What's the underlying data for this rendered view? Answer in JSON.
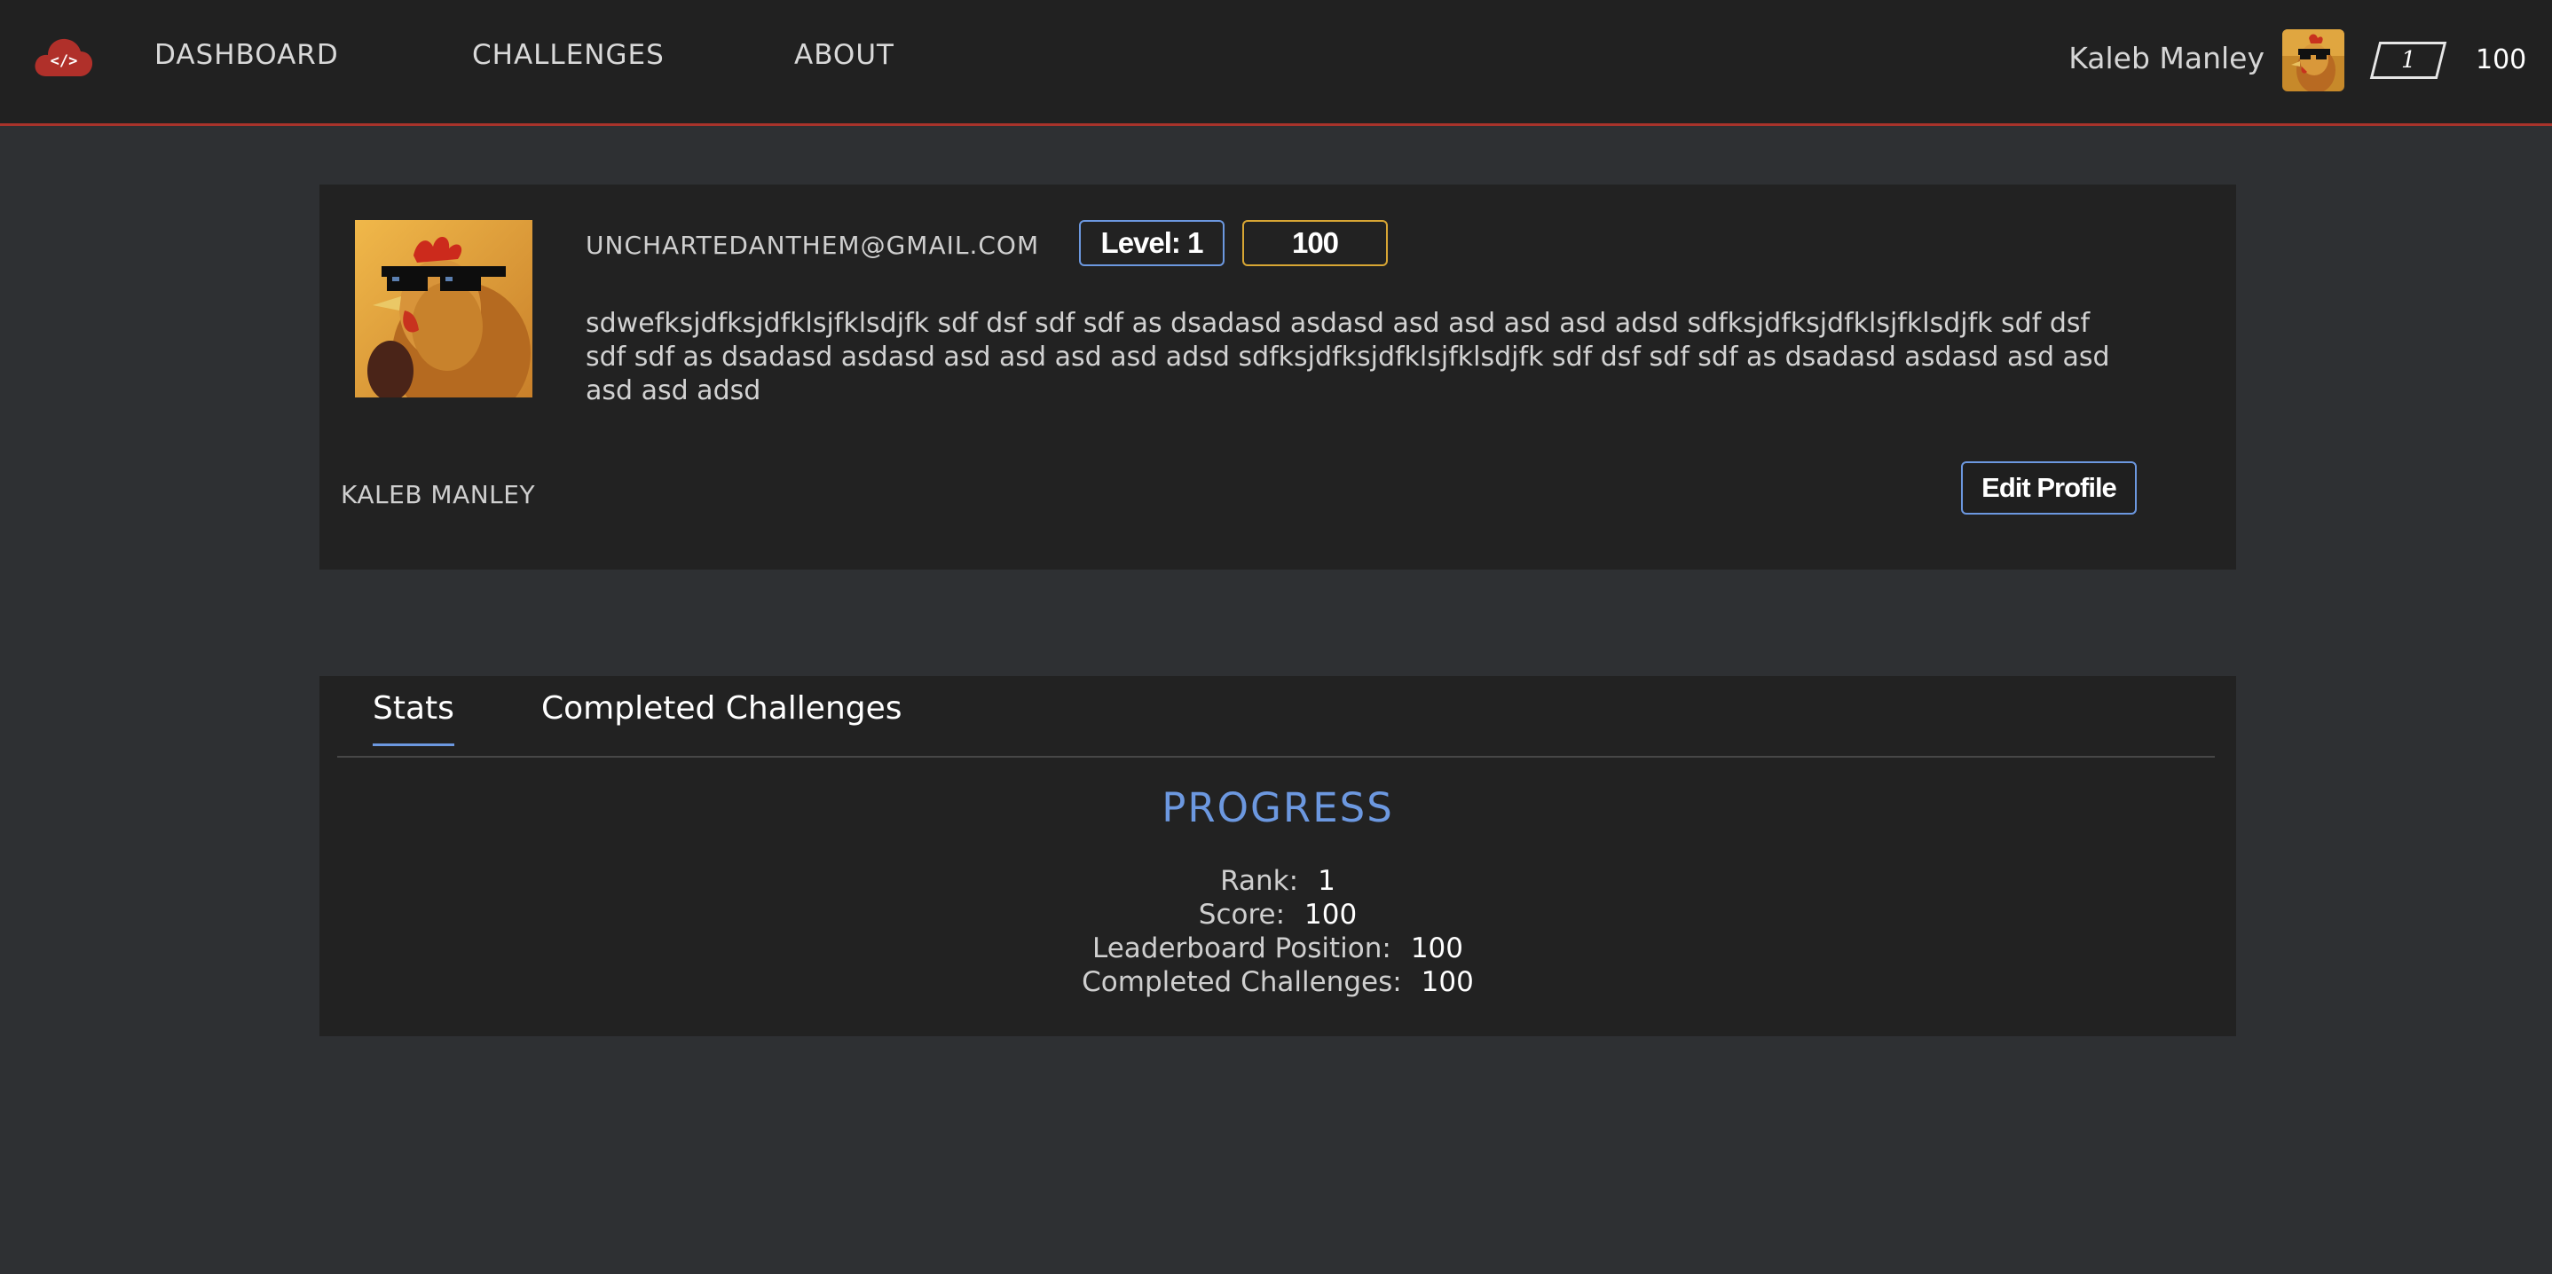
{
  "colors": {
    "brand": "#a8332b",
    "accent_blue": "#6c98e0",
    "accent_gold": "#d8a634",
    "background": "#2e3033",
    "card": "#222222"
  },
  "navbar": {
    "logo_icon": "cloud-code-icon",
    "links": [
      "DASHBOARD",
      "CHALLENGES",
      "ABOUT"
    ],
    "user_name": "Kaleb Manley",
    "avatar_icon": "chicken-sunglasses-avatar",
    "level": "1",
    "score": "100"
  },
  "profile": {
    "email": "UNCHARTEDANTHEM@GMAIL.COM",
    "level_badge": "Level: 1",
    "score_badge": "100",
    "bio": "sdwefksjdfksjdfklsjfklsdjfk sdf dsf sdf sdf as dsadasd asdasd asd asd asd asd adsd sdfksjdfksjdfklsjfklsdjfk sdf dsf sdf sdf as dsadasd asdasd asd asd asd asd adsd sdfksjdfksjdfklsjfklsdjfk sdf dsf sdf sdf as dsadasd asdasd asd asd asd asd adsd",
    "name": "KALEB MANLEY",
    "edit_button": "Edit Profile"
  },
  "stats": {
    "tabs": [
      "Stats",
      "Completed Challenges"
    ],
    "active_tab": "Stats",
    "progress_title": "PROGRESS",
    "rows": [
      {
        "label": "Rank:",
        "value": "1"
      },
      {
        "label": "Score:",
        "value": "100"
      },
      {
        "label": "Leaderboard Position:",
        "value": "100"
      },
      {
        "label": "Completed Challenges:",
        "value": "100"
      }
    ]
  }
}
